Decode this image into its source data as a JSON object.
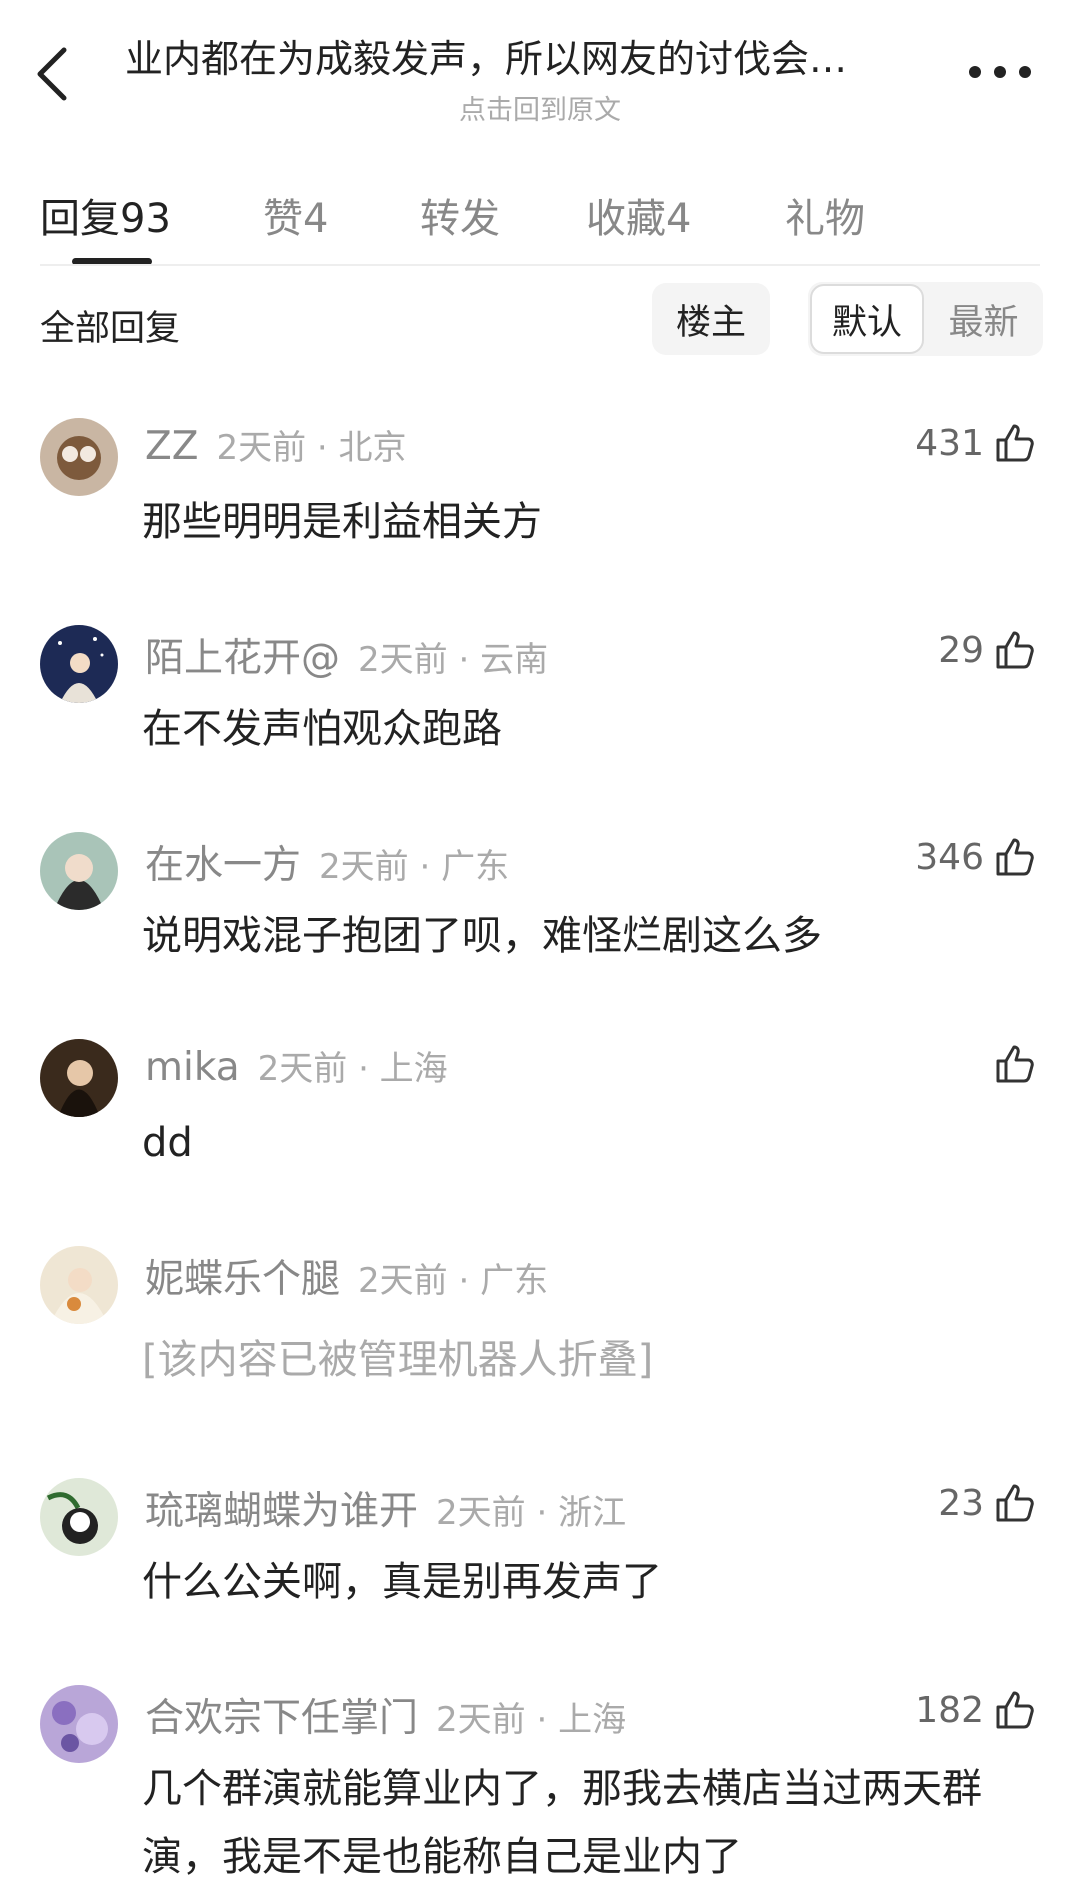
{
  "header": {
    "title": "业内都在为成毅发声，所以网友的讨伐会…",
    "subtitle": "点击回到原文"
  },
  "tabs": [
    {
      "label": "回复93"
    },
    {
      "label": "赞4"
    },
    {
      "label": "转发"
    },
    {
      "label": "收藏4"
    },
    {
      "label": "礼物"
    }
  ],
  "filter": {
    "title": "全部回复",
    "op_label": "楼主",
    "default_label": "默认",
    "latest_label": "最新"
  },
  "comments": [
    {
      "name": "ZZ",
      "meta": "2天前 · 北京",
      "likes": "431",
      "text": "那些明明是利益相关方"
    },
    {
      "name": "陌上花开@",
      "meta": "2天前 · 云南",
      "likes": "29",
      "text": "在不发声怕观众跑路"
    },
    {
      "name": "在水一方",
      "meta": "2天前 · 广东",
      "likes": "346",
      "text": "说明戏混子抱团了呗，难怪烂剧这么多"
    },
    {
      "name": "mika",
      "meta": "2天前 · 上海",
      "likes": "",
      "text": "dd"
    },
    {
      "name": "妮蝶乐个腿",
      "meta": "2天前 · 广东",
      "likes": "",
      "text": "[该内容已被管理机器人折叠]"
    },
    {
      "name": "琉璃蝴蝶为谁开",
      "meta": "2天前 · 浙江",
      "likes": "23",
      "text": "什么公关啊，真是别再发声了"
    },
    {
      "name": "合欢宗下任掌门",
      "meta": "2天前 · 上海",
      "likes": "182",
      "text": "几个群演就能算业内了，那我去横店当过两天群演，我是不是也能称自己是业内了"
    }
  ]
}
